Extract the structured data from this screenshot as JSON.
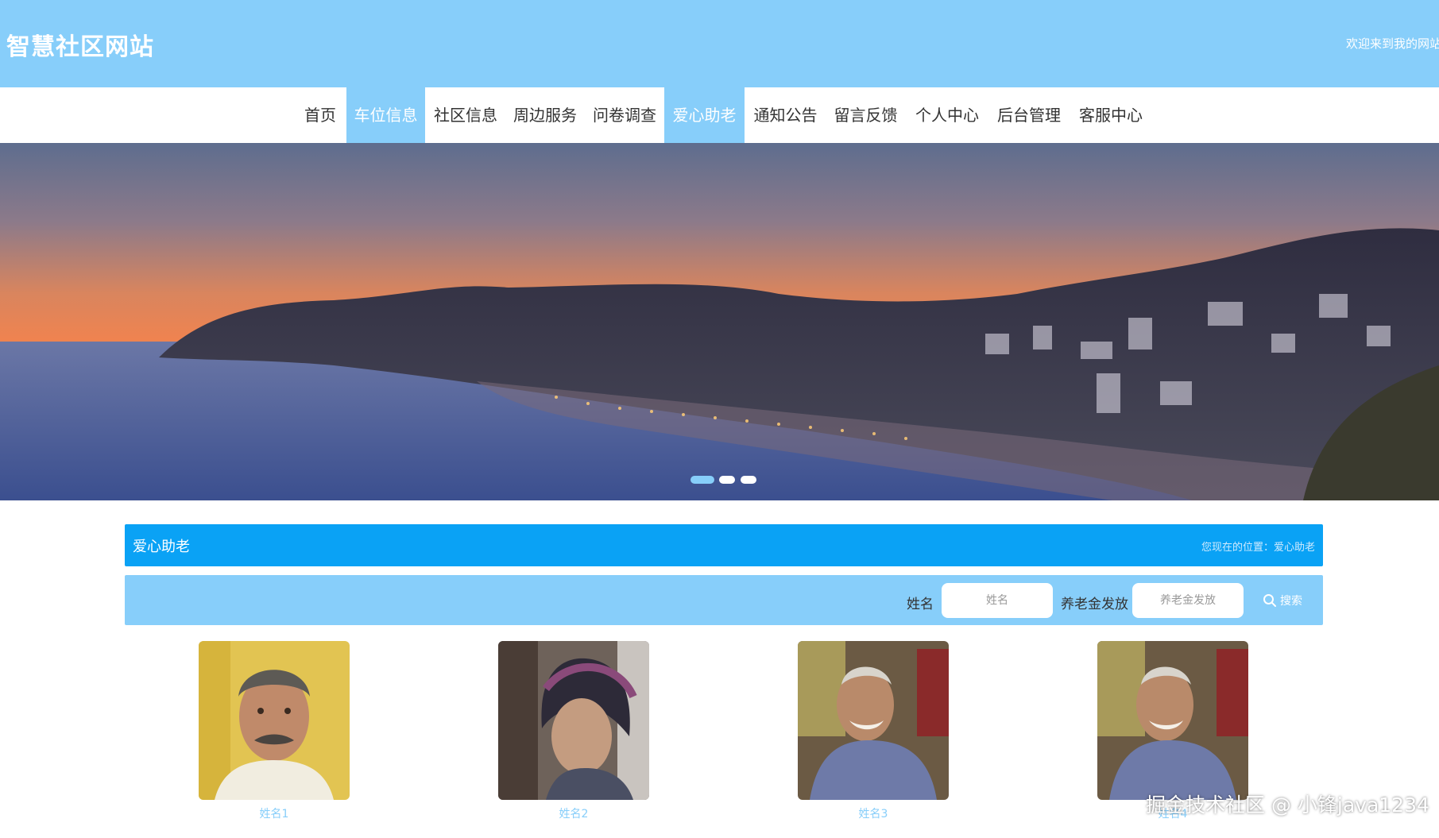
{
  "header": {
    "site_title": "智慧社区网站",
    "welcome_text": "欢迎来到我的网站"
  },
  "nav": {
    "items": [
      {
        "label": "首页"
      },
      {
        "label": "车位信息"
      },
      {
        "label": "社区信息"
      },
      {
        "label": "周边服务"
      },
      {
        "label": "问卷调查"
      },
      {
        "label": "爱心助老"
      },
      {
        "label": "通知公告"
      },
      {
        "label": "留言反馈"
      },
      {
        "label": "个人中心"
      },
      {
        "label": "后台管理"
      },
      {
        "label": "客服中心"
      }
    ],
    "active_items": [
      "车位信息",
      "爱心助老"
    ]
  },
  "banner": {
    "description_icon": "coastal-town-sunset-photo",
    "slide_count": 3,
    "active_slide": 1
  },
  "section": {
    "title": "爱心助老",
    "location_text": "您现在的位置：爱心助老"
  },
  "search": {
    "name_label": "姓名",
    "name_placeholder": "姓名",
    "pension_label": "养老金发放",
    "pension_placeholder": "养老金发放",
    "button_label": "搜索",
    "button_icon": "search-icon"
  },
  "cards": [
    {
      "name": "姓名1",
      "photo_icon": "elderly-man-portrait"
    },
    {
      "name": "姓名2",
      "photo_icon": "elderly-woman-headscarf-portrait"
    },
    {
      "name": "姓名3",
      "photo_icon": "smiling-elderly-man-portrait"
    },
    {
      "name": "姓名4",
      "photo_icon": "smiling-elderly-man-portrait"
    }
  ],
  "watermark": "掘金技术社区 @ 小锋java1234",
  "colors": {
    "header_bg": "#87cefa",
    "nav_active_bg": "#87cefa",
    "section_bar_bg": "#0aa2f5",
    "search_bar_bg": "#87cefa",
    "card_name": "#87cefa"
  }
}
